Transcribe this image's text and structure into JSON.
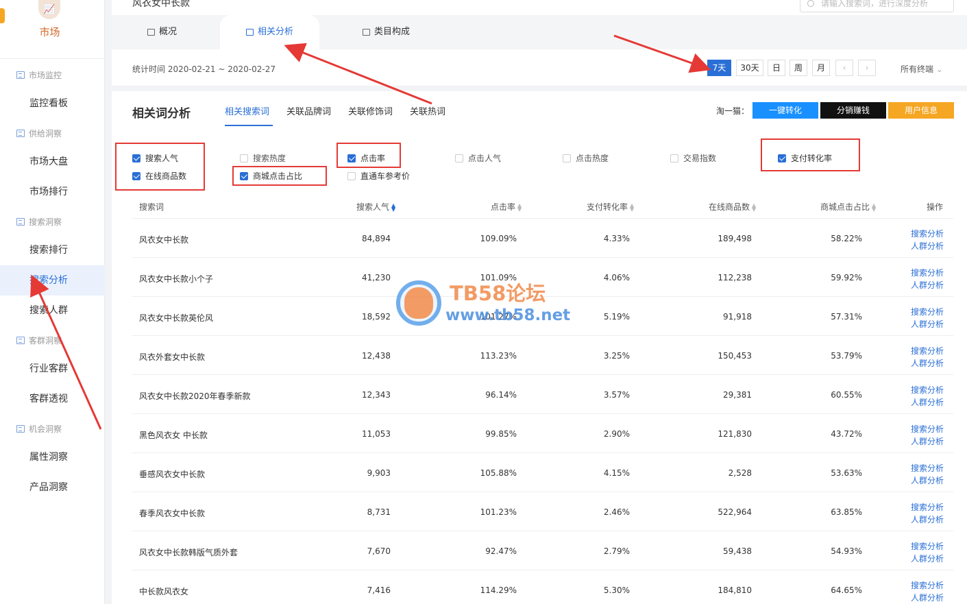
{
  "sidebar": {
    "title": "市场",
    "groups": [
      {
        "label": "市场监控",
        "items": [
          "监控看板"
        ]
      },
      {
        "label": "供给洞察",
        "items": [
          "市场大盘",
          "市场排行"
        ]
      },
      {
        "label": "搜索洞察",
        "items": [
          "搜索排行",
          "搜索分析",
          "搜索人群"
        ]
      },
      {
        "label": "客群洞察",
        "items": [
          "行业客群",
          "客群透视"
        ]
      },
      {
        "label": "机会洞察",
        "items": [
          "属性洞察",
          "产品洞察"
        ]
      }
    ],
    "active_item": "搜索分析"
  },
  "header": {
    "keyword_title": "风衣女中长款",
    "search_placeholder": "请输入搜索词，进行深度分析",
    "tabs": [
      "概况",
      "相关分析",
      "类目构成"
    ],
    "active_tab": "相关分析",
    "stat_time": "统计时间 2020-02-21 ~ 2020-02-27",
    "time_buttons": [
      "7天",
      "30天",
      "日",
      "周",
      "月"
    ],
    "prev_icon": "chevron-left-icon",
    "next_icon": "chevron-right-icon",
    "device_select": "所有终端"
  },
  "analysis": {
    "title": "相关词分析",
    "subtabs": [
      "相关搜索词",
      "关联品牌词",
      "关联修饰词",
      "关联热词"
    ],
    "active_subtab": "相关搜索词",
    "plugin_label": "淘一猫：",
    "action_buttons": [
      {
        "label": "一键转化",
        "color": "#1890ff"
      },
      {
        "label": "分销赚钱",
        "color": "#111111"
      },
      {
        "label": "用户信息",
        "color": "#f5a623"
      }
    ],
    "metrics": [
      {
        "label": "搜索人气",
        "checked": true
      },
      {
        "label": "搜索热度",
        "checked": false
      },
      {
        "label": "点击率",
        "checked": true
      },
      {
        "label": "点击人气",
        "checked": false
      },
      {
        "label": "点击热度",
        "checked": false
      },
      {
        "label": "交易指数",
        "checked": false
      },
      {
        "label": "支付转化率",
        "checked": true
      },
      {
        "label": "在线商品数",
        "checked": true
      },
      {
        "label": "商城点击占比",
        "checked": true
      },
      {
        "label": "直通车参考价",
        "checked": false
      }
    ]
  },
  "table": {
    "columns": [
      "搜索词",
      "搜索人气",
      "点击率",
      "支付转化率",
      "在线商品数",
      "商城点击占比",
      "操作"
    ],
    "op_links": [
      "搜索分析",
      "人群分析"
    ],
    "rows": [
      [
        "风衣女中长款",
        "84,894",
        "109.09%",
        "4.33%",
        "189,498",
        "58.22%"
      ],
      [
        "风衣女中长款小个子",
        "41,230",
        "101.09%",
        "4.06%",
        "112,238",
        "59.92%"
      ],
      [
        "风衣女中长款英伦风",
        "18,592",
        "101.27%",
        "5.19%",
        "91,918",
        "57.31%"
      ],
      [
        "风衣外套女中长款",
        "12,438",
        "113.23%",
        "3.25%",
        "150,453",
        "53.79%"
      ],
      [
        "风衣女中长款2020年春季新款",
        "12,343",
        "96.14%",
        "3.57%",
        "29,381",
        "60.55%"
      ],
      [
        "黑色风衣女 中长款",
        "11,053",
        "99.85%",
        "2.90%",
        "121,830",
        "43.72%"
      ],
      [
        "垂感风衣女中长款",
        "9,903",
        "105.88%",
        "4.15%",
        "2,528",
        "53.63%"
      ],
      [
        "春季风衣女中长款",
        "8,731",
        "101.23%",
        "2.46%",
        "522,964",
        "63.85%"
      ],
      [
        "风衣女中长款韩版气质外套",
        "7,670",
        "92.47%",
        "2.79%",
        "59,438",
        "54.93%"
      ],
      [
        "中长款风衣女",
        "7,416",
        "114.29%",
        "5.30%",
        "184,810",
        "64.65%"
      ]
    ]
  },
  "watermark": {
    "line1": "TB58论坛",
    "line2": "www.tb58.net"
  }
}
